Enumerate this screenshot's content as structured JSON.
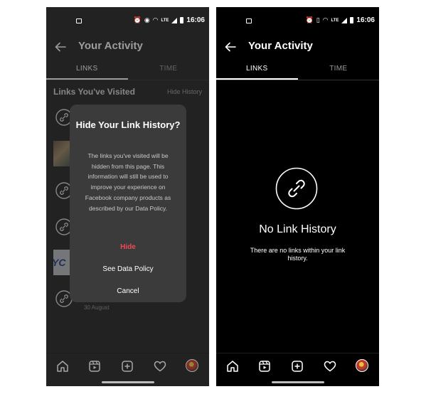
{
  "status_bar": {
    "time": "16:06",
    "network": "LTE"
  },
  "left_screen": {
    "title": "Your Activity",
    "tabs": [
      {
        "label": "LINKS",
        "active": true
      },
      {
        "label": "TIME",
        "active": false
      }
    ],
    "section_title": "Links You've Visited",
    "hide_history_label": "Hide History",
    "last_visible_date": "30 August",
    "dialog": {
      "title": "Hide Your Link History?",
      "body": "The links you've visited will be hidden from this page. This information will still be used to improve your experience on Facebook company products as described by our Data Policy.",
      "hide_label": "Hide",
      "data_policy_label": "See Data Policy",
      "cancel_label": "Cancel"
    }
  },
  "right_screen": {
    "title": "Your Activity",
    "tabs": [
      {
        "label": "LINKS",
        "active": true
      },
      {
        "label": "TIME",
        "active": false
      }
    ],
    "empty_title": "No Link History",
    "empty_text": "There are no links within your link history."
  },
  "bottom_nav": [
    "home-icon",
    "reels-icon",
    "create-icon",
    "heart-icon",
    "profile-avatar"
  ],
  "colors": {
    "left_background": "#222222",
    "right_background": "#000000",
    "dialog_background": "#3b3b3b",
    "destructive": "#ed4956",
    "text": "#ffffff"
  }
}
